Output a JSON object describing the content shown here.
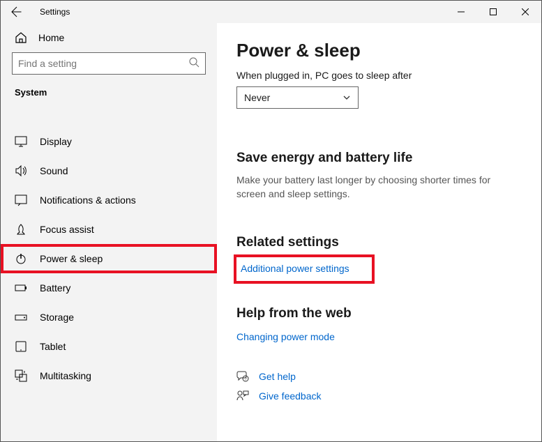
{
  "titlebar": {
    "title": "Settings"
  },
  "sidebar": {
    "home": "Home",
    "search_placeholder": "Find a setting",
    "category": "System",
    "items": [
      {
        "label": "Display"
      },
      {
        "label": "Sound"
      },
      {
        "label": "Notifications & actions"
      },
      {
        "label": "Focus assist"
      },
      {
        "label": "Power & sleep"
      },
      {
        "label": "Battery"
      },
      {
        "label": "Storage"
      },
      {
        "label": "Tablet"
      },
      {
        "label": "Multitasking"
      }
    ]
  },
  "main": {
    "title": "Power & sleep",
    "plugged_label": "When plugged in, PC goes to sleep after",
    "plugged_value": "Never",
    "energy_title": "Save energy and battery life",
    "energy_text": "Make your battery last longer by choosing shorter times for screen and sleep settings.",
    "related_title": "Related settings",
    "additional_link": "Additional power settings",
    "help_title": "Help from the web",
    "help_link": "Changing power mode",
    "get_help": "Get help",
    "give_feedback": "Give feedback"
  }
}
